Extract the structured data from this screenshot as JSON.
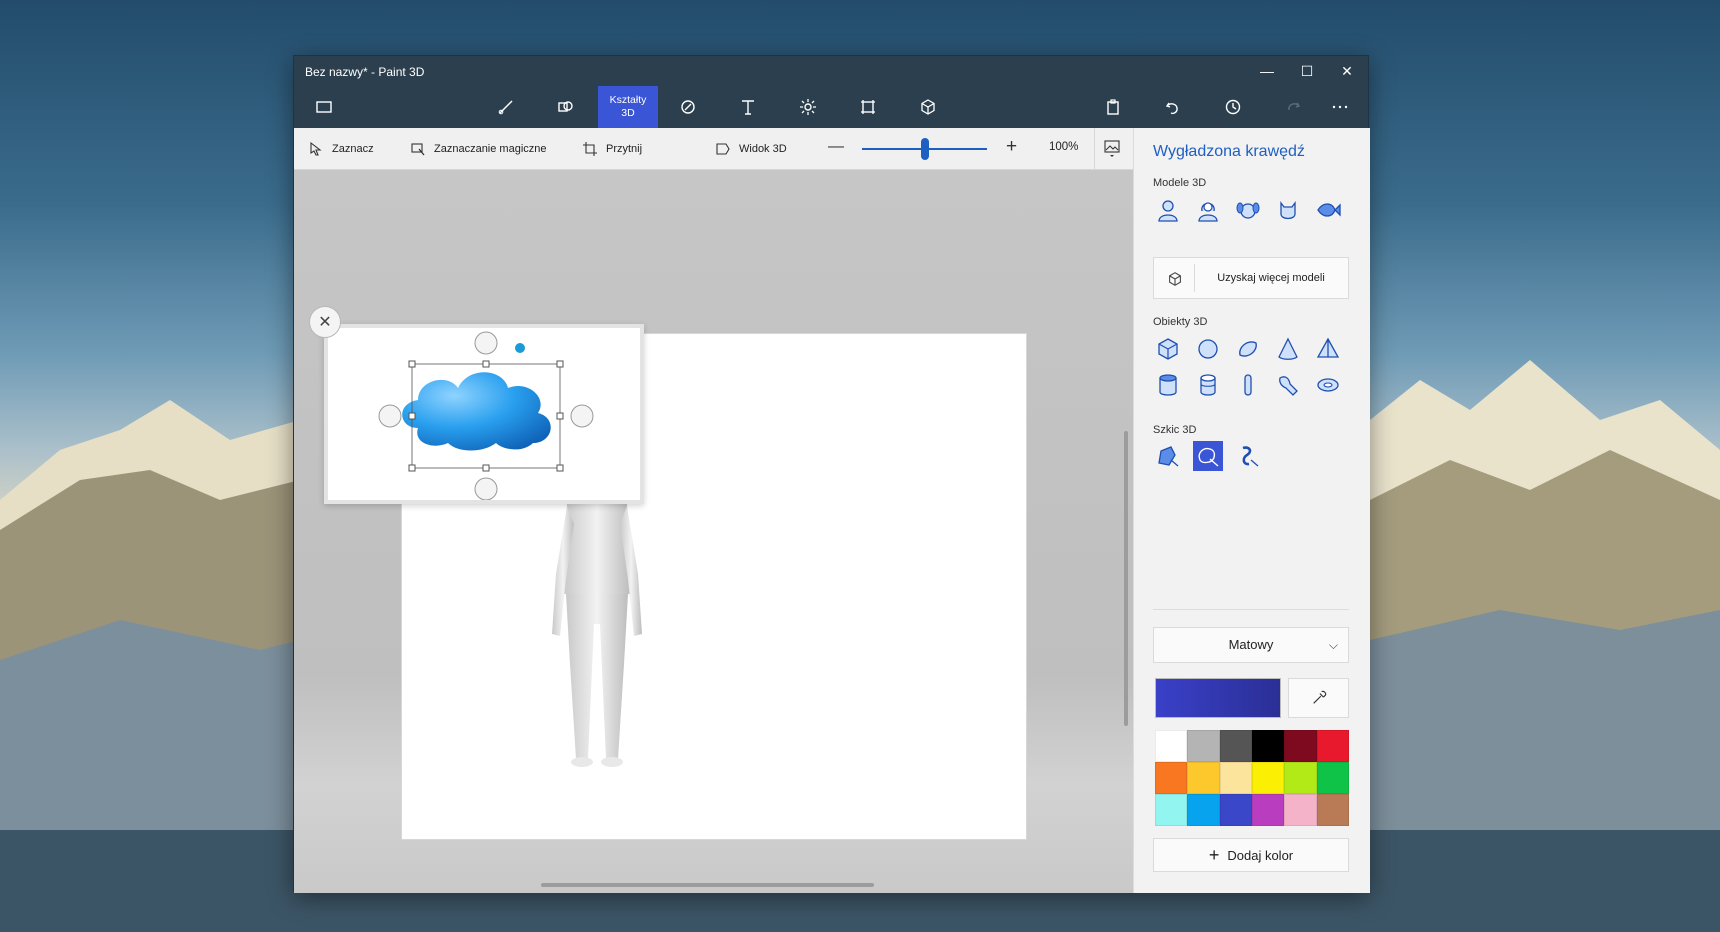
{
  "window": {
    "title": "Bez nazwy* - Paint 3D",
    "controls": {
      "minimize": "—",
      "maximize": "☐",
      "close": "✕"
    }
  },
  "toolbar": {
    "active_tab_line1": "Kształty",
    "active_tab_line2": "3D",
    "icons": [
      "menu-icon",
      "brush-icon",
      "2d-shapes-icon",
      "3d-shapes-icon",
      "stickers-icon",
      "text-icon",
      "effects-icon",
      "canvas-icon",
      "remix3d-icon",
      "paste-icon",
      "undo-icon",
      "history-icon",
      "redo-icon",
      "more-icon"
    ]
  },
  "subbar": {
    "select": "Zaznacz",
    "magic_select": "Zaznaczanie magiczne",
    "crop": "Przytnij",
    "view3d": "Widok 3D",
    "zoom_percent": "100%",
    "zoom_level": 0.5
  },
  "panel": {
    "title": "Wygładzona krawędź",
    "models_label": "Modele 3D",
    "more_models": "Uzyskaj więcej modeli",
    "objects_label": "Obiekty 3D",
    "sketch_label": "Szkic 3D",
    "finish": "Matowy",
    "add_color": "Dodaj kolor",
    "current_color": "#3a40c8",
    "swatches": [
      "#ffffff",
      "#b4b4b4",
      "#555555",
      "#000000",
      "#7d0a1e",
      "#e8182d",
      "#f87720",
      "#fdc82c",
      "#fde49d",
      "#fbf003",
      "#b2ea17",
      "#0fc348",
      "#93f5ef",
      "#08a3ee",
      "#3b47c9",
      "#b93ebf",
      "#f5b3ca",
      "#b97b55"
    ]
  }
}
